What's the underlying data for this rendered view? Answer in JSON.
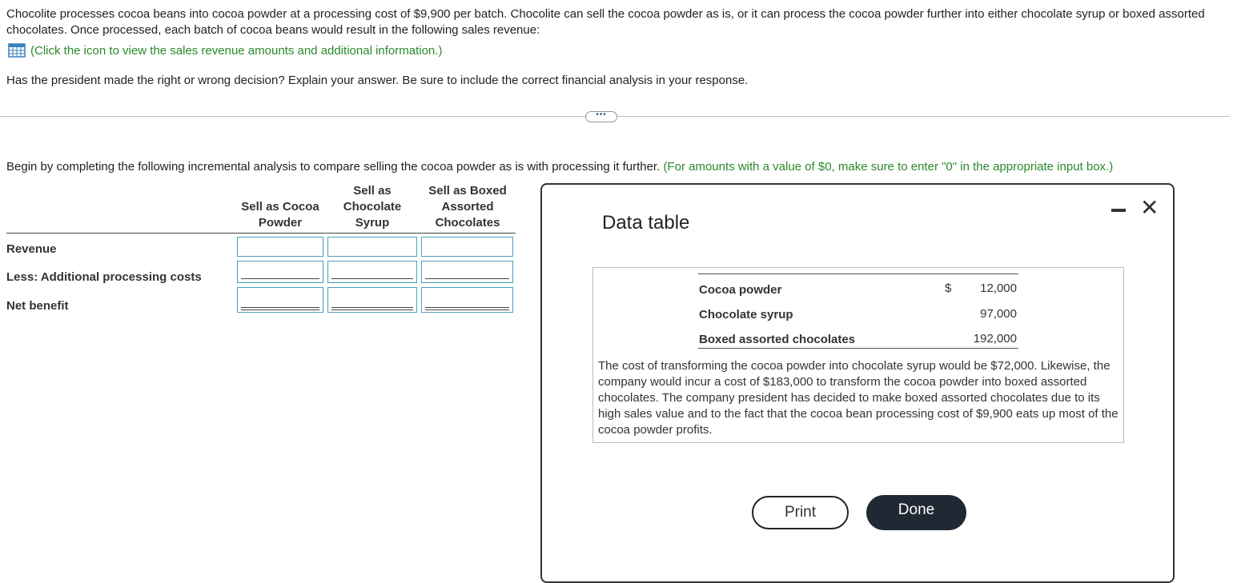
{
  "problem": {
    "intro": "Chocolite processes cocoa beans into cocoa powder at a processing cost of $9,900 per batch. Chocolite can sell the cocoa powder as is, or it can process the cocoa powder further into either chocolate syrup or boxed assorted chocolates. Once processed, each batch of cocoa beans would result in the following sales revenue:",
    "link_text": "(Click the icon to view the sales revenue amounts and additional information.)",
    "question": "Has the president made the right or wrong decision? Explain your answer. Be sure to include the correct financial analysis in your response.",
    "more_label": "•••"
  },
  "analysis": {
    "instruction": "Begin by completing the following incremental analysis to compare selling the cocoa powder as is with processing it further.",
    "instruction_note": "(For amounts with a value of $0, make sure to enter \"0\" in the appropriate input box.)",
    "columns": [
      [
        "Sell as Cocoa",
        "Powder"
      ],
      [
        "Sell as",
        "Chocolate",
        "Syrup"
      ],
      [
        "Sell as Boxed",
        "Assorted",
        "Chocolates"
      ]
    ],
    "rows": [
      "Revenue",
      "Less: Additional processing costs",
      "Net benefit"
    ]
  },
  "dialog": {
    "title": "Data table",
    "items": [
      {
        "label": "Cocoa powder",
        "currency": "$",
        "value": "12,000"
      },
      {
        "label": "Chocolate syrup",
        "currency": "",
        "value": "97,000"
      },
      {
        "label": "Boxed assorted chocolates",
        "currency": "",
        "value": "192,000"
      }
    ],
    "note": "The cost of transforming the cocoa powder into chocolate syrup would be $72,000. Likewise, the company would incur a cost of $183,000 to transform the cocoa powder into boxed assorted chocolates. The company president has decided to make boxed assorted chocolates due to its high sales value and to the fact that the cocoa bean processing cost of $9,900 eats up most of the cocoa powder profits.",
    "print_label": "Print",
    "done_label": "Done",
    "close_label": "✕"
  }
}
